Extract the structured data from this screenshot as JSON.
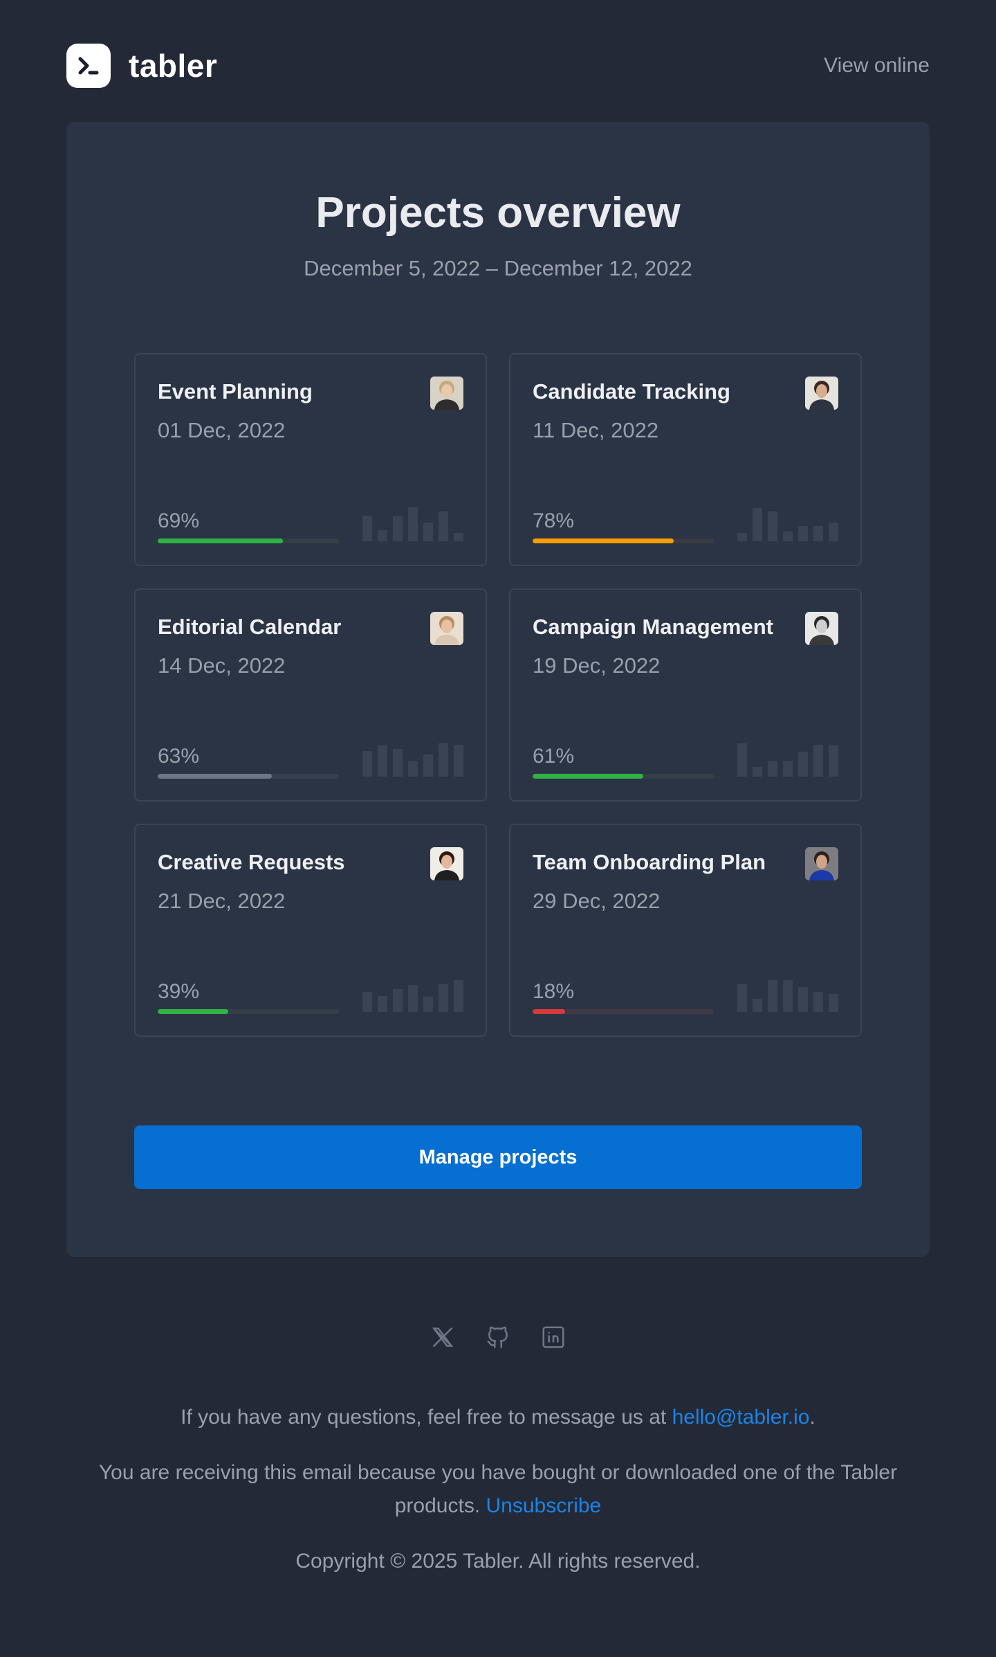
{
  "header": {
    "brand": "tabler",
    "view_online": "View online"
  },
  "main": {
    "title": "Projects overview",
    "subtitle": "December 5, 2022 – December 12, 2022",
    "projects": [
      {
        "name": "Event Planning",
        "date": "01 Dec, 2022",
        "percent_label": "69%",
        "progress": 69,
        "color": "#2fb344",
        "track": "#343f47",
        "avatar": "avatar-woman-1",
        "spark": [
          0.52,
          0.22,
          0.5,
          0.68,
          0.38,
          0.6,
          0.16
        ]
      },
      {
        "name": "Candidate Tracking",
        "date": "11 Dec, 2022",
        "percent_label": "78%",
        "progress": 78,
        "color": "#f59f00",
        "track": "#3b3c42",
        "avatar": "avatar-man-1",
        "spark": [
          0.16,
          0.66,
          0.6,
          0.2,
          0.3,
          0.3,
          0.38
        ]
      },
      {
        "name": "Editorial Calendar",
        "date": "14 Dec, 2022",
        "percent_label": "63%",
        "progress": 63,
        "color": "#6e7687",
        "track": "#364050",
        "avatar": "avatar-woman-2",
        "spark": [
          0.52,
          0.62,
          0.56,
          0.3,
          0.44,
          0.66,
          0.64
        ]
      },
      {
        "name": "Campaign Management",
        "date": "19 Dec, 2022",
        "percent_label": "61%",
        "progress": 61,
        "color": "#2fb344",
        "track": "#343f47",
        "avatar": "avatar-man-2",
        "spark": [
          0.66,
          0.2,
          0.3,
          0.32,
          0.5,
          0.64,
          0.62
        ]
      },
      {
        "name": "Creative Requests",
        "date": "21 Dec, 2022",
        "percent_label": "39%",
        "progress": 39,
        "color": "#2fb344",
        "track": "#343f47",
        "avatar": "avatar-woman-3",
        "spark": [
          0.4,
          0.32,
          0.46,
          0.54,
          0.3,
          0.56,
          0.64
        ]
      },
      {
        "name": "Team Onboarding Plan",
        "date": "29 Dec, 2022",
        "percent_label": "18%",
        "progress": 18,
        "color": "#d63939",
        "track": "#3e3944",
        "avatar": "avatar-man-3",
        "spark": [
          0.56,
          0.26,
          0.64,
          0.64,
          0.5,
          0.4,
          0.36
        ]
      }
    ],
    "cta": "Manage projects"
  },
  "footer": {
    "social_icons": [
      "x-icon",
      "github-icon",
      "linkedin-icon"
    ],
    "questions_text": "If you have any questions, feel free to message us at ",
    "email": "hello@tabler.io",
    "questions_end": ".",
    "receiving_text": "You are receiving this email because you have bought or downloaded one of the Tabler products. ",
    "unsubscribe": "Unsubscribe",
    "copyright": "Copyright © 2025 Tabler. All rights reserved."
  }
}
